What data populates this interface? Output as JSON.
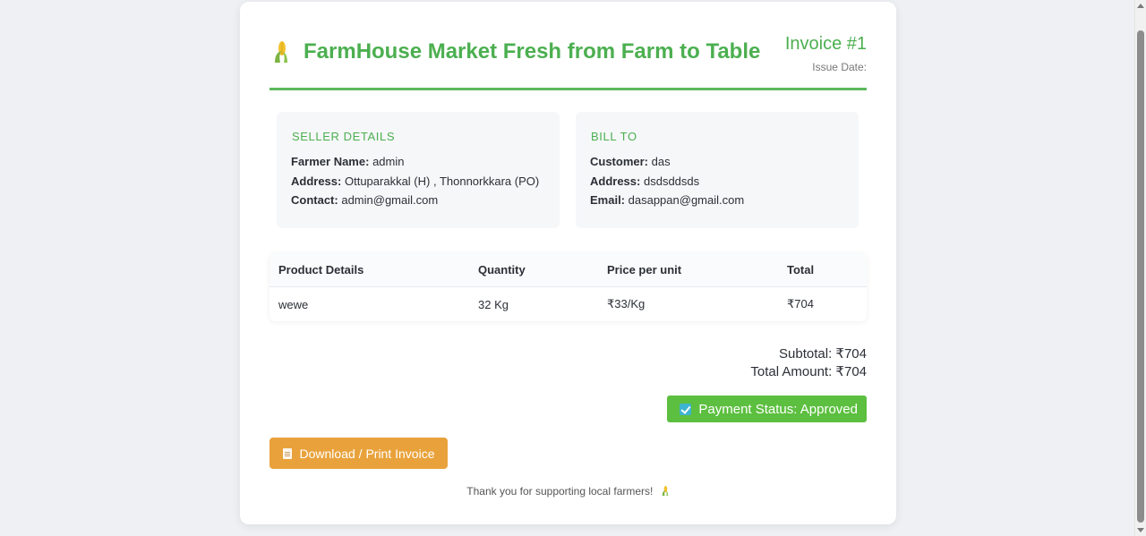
{
  "brand": {
    "name": "FarmHouse Market Fresh from Farm to Table",
    "icon": "corn-icon"
  },
  "invoice": {
    "number_label": "Invoice #1",
    "issue_date_label": "Issue Date:"
  },
  "seller": {
    "title": "SELLER DETAILS",
    "farmer_label": "Farmer Name:",
    "farmer_value": "admin",
    "address_label": "Address:",
    "address_value": "Ottuparakkal (H) , Thonnorkkara (PO)",
    "contact_label": "Contact:",
    "contact_value": "admin@gmail.com"
  },
  "bill_to": {
    "title": "BILL TO",
    "customer_label": "Customer:",
    "customer_value": "das",
    "address_label": "Address:",
    "address_value": "dsdsddsds",
    "email_label": "Email:",
    "email_value": "dasappan@gmail.com"
  },
  "table": {
    "headers": [
      "Product Details",
      "Quantity",
      "Price per unit",
      "Total"
    ],
    "rows": [
      [
        "wewe",
        "32 Kg",
        "₹33/Kg",
        "₹704"
      ]
    ]
  },
  "totals": {
    "subtotal": "Subtotal: ₹704",
    "total_amount": "Total Amount: ₹704"
  },
  "payment_status": {
    "label": "Payment Status: Approved",
    "icon": "check-icon",
    "color": "#5cbf3f"
  },
  "download_button": {
    "label": "Download / Print Invoice",
    "icon": "document-icon",
    "color": "#e9a23b"
  },
  "footer": {
    "message": "Thank you for supporting local farmers!"
  },
  "colors": {
    "accent": "#4caf50",
    "background": "#eef0f4"
  }
}
